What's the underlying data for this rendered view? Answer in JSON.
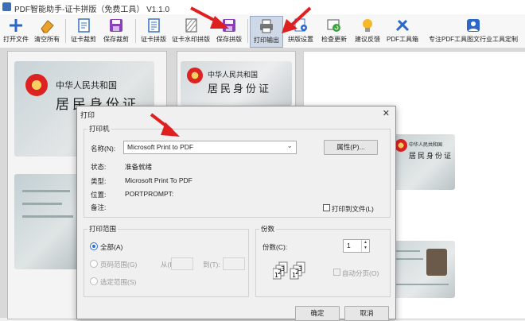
{
  "window": {
    "title": "PDF智能助手-证卡拼版（免费工具） V1.1.0"
  },
  "toolbar": {
    "buttons": [
      {
        "label": "打开文件",
        "icon": "plus-icon"
      },
      {
        "label": "清空所有",
        "icon": "eraser-icon"
      },
      {
        "label": "证卡裁剪",
        "icon": "crop-icon"
      },
      {
        "label": "保存裁剪",
        "icon": "save-icon"
      },
      {
        "label": "证卡拼版",
        "icon": "layout-icon"
      },
      {
        "label": "证卡水印拼版",
        "icon": "watermark-icon"
      },
      {
        "label": "保存拼版",
        "icon": "save-icon"
      },
      {
        "label": "打印输出",
        "icon": "printer-icon"
      },
      {
        "label": "拼版设置",
        "icon": "gear-icon"
      },
      {
        "label": "检查更新",
        "icon": "refresh-icon"
      },
      {
        "label": "建议反馈",
        "icon": "lightbulb-icon"
      },
      {
        "label": "PDF工具箱",
        "icon": "tools-icon"
      },
      {
        "label": "专注PDF工具图文行业工具定制",
        "icon": "person-icon"
      }
    ]
  },
  "cards": {
    "country": "中华人民共和国",
    "doc_name": "居民身份证"
  },
  "dialog": {
    "title": "打印",
    "close": "✕",
    "printer_group": "打印机",
    "name_label": "名称(N):",
    "name_value": "Microsoft Print to PDF",
    "properties_button": "属性(P)...",
    "status_label": "状态:",
    "status_value": "准备就绪",
    "type_label": "类型:",
    "type_value": "Microsoft Print To PDF",
    "where_label": "位置:",
    "where_value": "PORTPROMPT:",
    "comment_label": "备注:",
    "print_to_file": "打印到文件(L)",
    "range_group": "打印范围",
    "range_all": "全部(A)",
    "range_pages": "页码范围(G)",
    "from_label": "从(F):",
    "to_label": "到(T):",
    "range_selection": "选定范围(S)",
    "copies_group": "份数",
    "copies_label": "份数(C):",
    "copies_value": "1",
    "collate": "自动分页(O)",
    "ok": "确定",
    "cancel": "取消"
  },
  "colors": {
    "accent": "#2a6dd9",
    "arrow": "#e02020",
    "toolbar_active": "#cfd8e6"
  }
}
